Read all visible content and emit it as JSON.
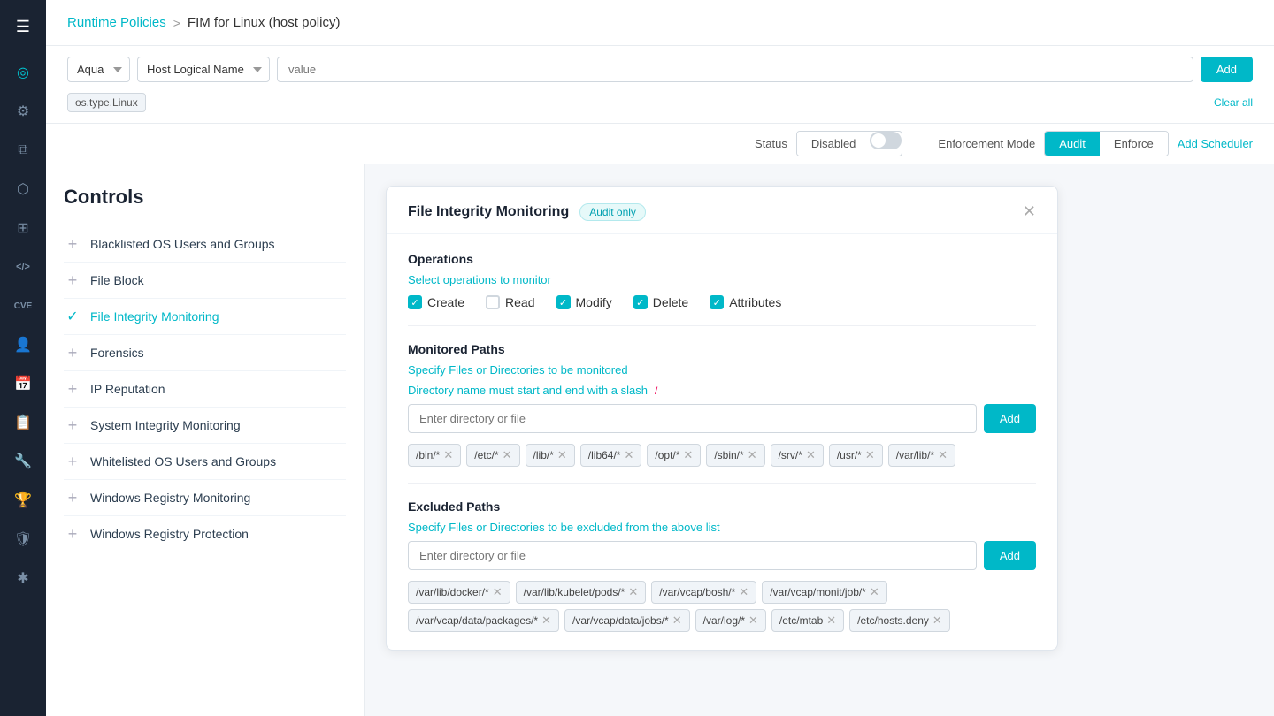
{
  "sidebar": {
    "icons": [
      {
        "name": "hamburger-icon",
        "symbol": "☰"
      },
      {
        "name": "dashboard-icon",
        "symbol": "◎"
      },
      {
        "name": "settings-icon",
        "symbol": "⚙"
      },
      {
        "name": "layers-icon",
        "symbol": "⧉"
      },
      {
        "name": "network-icon",
        "symbol": "⬡"
      },
      {
        "name": "grid-icon",
        "symbol": "⊞"
      },
      {
        "name": "code-icon",
        "symbol": "</>"
      },
      {
        "name": "cve-icon",
        "symbol": "CVE"
      },
      {
        "name": "users-icon",
        "symbol": "👤"
      },
      {
        "name": "calendar-icon",
        "symbol": "📅"
      },
      {
        "name": "reports-icon",
        "symbol": "📋"
      },
      {
        "name": "wrench-icon",
        "symbol": "🔧"
      },
      {
        "name": "trophy-icon",
        "symbol": "🏆"
      },
      {
        "name": "shield-icon",
        "symbol": "🛡"
      },
      {
        "name": "star-icon",
        "symbol": "✱"
      }
    ]
  },
  "topbar": {
    "breadcrumb_link": "Runtime Policies",
    "breadcrumb_sep": ">",
    "breadcrumb_current": "FIM for Linux (host policy)"
  },
  "filterbar": {
    "scope_options": [
      "Aqua"
    ],
    "scope_selected": "Aqua",
    "filter_options": [
      "Host Logical Name"
    ],
    "filter_selected": "Host Logical Name",
    "value_placeholder": "value",
    "add_label": "Add",
    "clear_label": "Clear all",
    "active_filter": "os.type.Linux"
  },
  "policy_meta": {
    "status_label": "Status",
    "status_disabled": "Disabled",
    "enforcement_label": "Enforcement Mode",
    "audit_label": "Audit",
    "enforce_label": "Enforce",
    "scheduler_label": "Add Scheduler"
  },
  "controls": {
    "title": "Controls",
    "items": [
      {
        "id": "blacklisted-os",
        "label": "Blacklisted OS Users and Groups",
        "selected": false,
        "checked": false
      },
      {
        "id": "file-block",
        "label": "File Block",
        "selected": false,
        "checked": false
      },
      {
        "id": "file-integrity",
        "label": "File Integrity Monitoring",
        "selected": true,
        "checked": true
      },
      {
        "id": "forensics",
        "label": "Forensics",
        "selected": false,
        "checked": false
      },
      {
        "id": "ip-reputation",
        "label": "IP Reputation",
        "selected": false,
        "checked": false
      },
      {
        "id": "system-integrity",
        "label": "System Integrity Monitoring",
        "selected": false,
        "checked": false
      },
      {
        "id": "whitelisted-os",
        "label": "Whitelisted OS Users and Groups",
        "selected": false,
        "checked": false
      },
      {
        "id": "win-reg-monitoring",
        "label": "Windows Registry Monitoring",
        "selected": false,
        "checked": false
      },
      {
        "id": "win-reg-protection",
        "label": "Windows Registry Protection",
        "selected": false,
        "checked": false
      }
    ]
  },
  "fim_modal": {
    "title": "File Integrity Monitoring",
    "badge": "Audit only",
    "ops_section": "Operations",
    "ops_select_text": "Select operations to monitor",
    "operations": [
      {
        "id": "create",
        "label": "Create",
        "checked": true
      },
      {
        "id": "read",
        "label": "Read",
        "checked": false
      },
      {
        "id": "modify",
        "label": "Modify",
        "checked": true
      },
      {
        "id": "delete",
        "label": "Delete",
        "checked": true
      },
      {
        "id": "attributes",
        "label": "Attributes",
        "checked": true
      }
    ],
    "monitored_paths_label": "Monitored Paths",
    "monitored_hint": "Specify Files or Directories to be monitored",
    "monitored_hint2": "Directory name must start and end with a slash",
    "monitored_hint2_icon": "/",
    "monitored_placeholder": "Enter directory or file",
    "monitored_add": "Add",
    "monitored_tags": [
      "/bin/*",
      "/etc/*",
      "/lib/*",
      "/lib64/*",
      "/opt/*",
      "/sbin/*",
      "/srv/*",
      "/usr/*",
      "/var/lib/*"
    ],
    "excluded_paths_label": "Excluded Paths",
    "excluded_hint": "Specify Files or Directories to be excluded from the above list",
    "excluded_placeholder": "Enter directory or file",
    "excluded_add": "Add",
    "excluded_tags": [
      "/var/lib/docker/*",
      "/var/lib/kubelet/pods/*",
      "/var/vcap/bosh/*",
      "/var/vcap/monit/job/*",
      "/var/vcap/data/packages/*",
      "/var/vcap/data/jobs/*",
      "/var/log/*",
      "/etc/mtab",
      "/etc/hosts.deny"
    ]
  }
}
